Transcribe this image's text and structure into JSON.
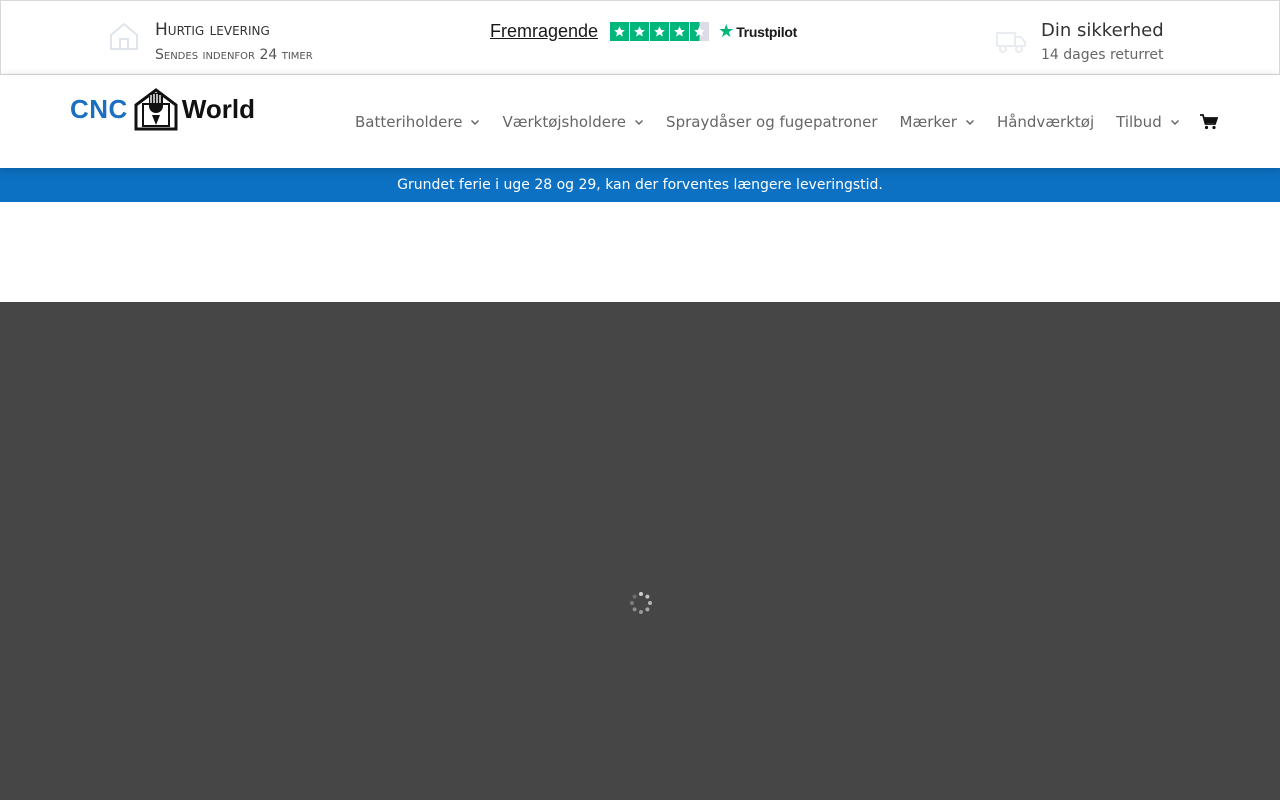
{
  "topbar": {
    "usp_left": {
      "icon": "house-icon",
      "title": "Hurtig levering",
      "subtitle": "Sendes indenfor 24 timer"
    },
    "trustpilot": {
      "rating_text": "Fremragende",
      "stars": 4.5,
      "brand": "Trustpilot",
      "color": "#00b67a"
    },
    "usp_right": {
      "icon": "truck-icon",
      "title": "Din sikkerhed",
      "subtitle": "14 dages returret"
    }
  },
  "header": {
    "logo": {
      "left": "CNC",
      "right": "World",
      "accent": "#1a6fc0"
    },
    "nav": [
      {
        "label": "Batteriholdere",
        "has_dropdown": true
      },
      {
        "label": "Værktøjsholdere",
        "has_dropdown": true
      },
      {
        "label": "Spraydåser og fugepatroner",
        "has_dropdown": false
      },
      {
        "label": "Mærker",
        "has_dropdown": true
      },
      {
        "label": "Håndværktøj",
        "has_dropdown": false
      },
      {
        "label": "Tilbud",
        "has_dropdown": true
      }
    ],
    "cart_icon": "cart-icon"
  },
  "notice": {
    "text": "Grundet ferie i uge 28 og 29, kan der forventes længere leveringstid.",
    "color": "#0c71c3"
  },
  "loader": {
    "icon": "spinner-icon",
    "background": "#464646"
  }
}
